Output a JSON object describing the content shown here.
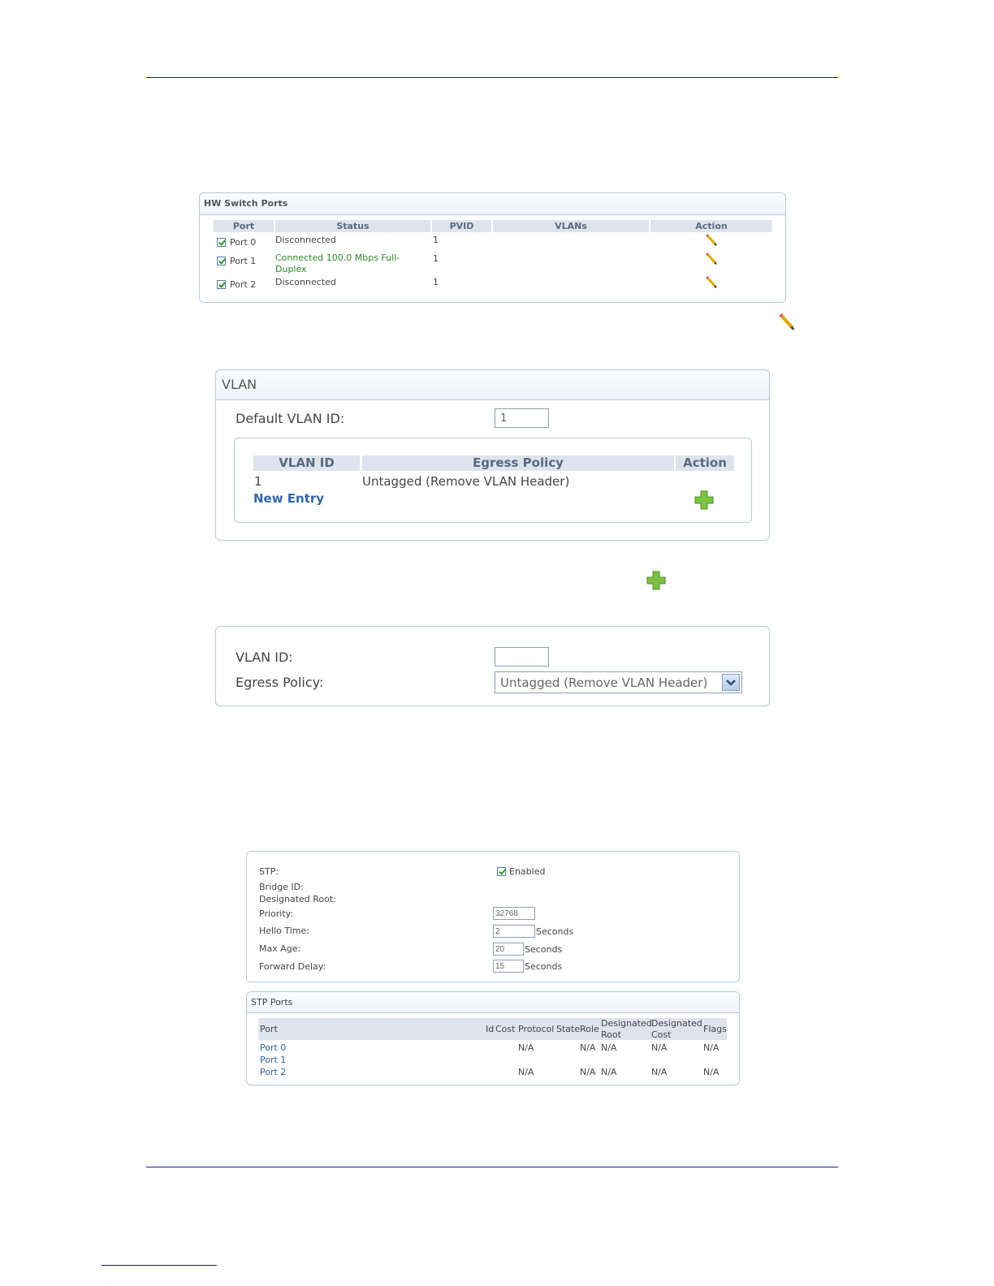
{
  "hw_switch": {
    "title": "HW Switch Ports",
    "headers": [
      "Port",
      "Status",
      "PVID",
      "VLANs",
      "Action"
    ],
    "rows": [
      {
        "port": "Port 0",
        "status_lines": [
          "Disconnected",
          ""
        ],
        "pvid": "1",
        "vlans": "",
        "connected": false
      },
      {
        "port": "Port 1",
        "status_lines": [
          "Connected 100.0 Mbps Full-",
          "Duplex"
        ],
        "pvid": "1",
        "vlans": "",
        "connected": true
      },
      {
        "port": "Port 2",
        "status_lines": [
          "Disconnected",
          ""
        ],
        "pvid": "1",
        "vlans": "",
        "connected": false
      }
    ]
  },
  "vlan": {
    "title": "VLAN",
    "default_label": "Default VLAN ID:",
    "default_value": "1",
    "headers": [
      "VLAN ID",
      "Egress Policy",
      "Action"
    ],
    "row": {
      "id": "1",
      "policy": "Untagged (Remove VLAN Header)"
    },
    "new_entry": "New Entry"
  },
  "vlan_form": {
    "id_label": "VLAN ID:",
    "id_value": "",
    "policy_label": "Egress Policy:",
    "policy_value": "Untagged (Remove VLAN Header)"
  },
  "stp": {
    "stp_label": "STP:",
    "enabled_label": "Enabled",
    "bridge_id_label": "Bridge ID:",
    "designated_root_label": "Designated Root:",
    "priority_label": "Priority:",
    "priority_value": "32768",
    "hello_label": "Hello Time:",
    "hello_value": "2",
    "max_age_label": "Max Age:",
    "max_age_value": "20",
    "fwd_label": "Forward Delay:",
    "fwd_value": "15",
    "seconds": "Seconds"
  },
  "stp_ports": {
    "title": "STP Ports",
    "headers": {
      "port": "Port",
      "id": "Id",
      "cost": "Cost",
      "protocol": "Protocol",
      "state": "State",
      "role": "Role",
      "droot_1": "Designated",
      "droot_2": "Root",
      "dcost_1": "Designated",
      "dcost_2": "Cost",
      "flags": "Flags"
    },
    "rows": [
      {
        "port": "Port 0",
        "protocol": "N/A",
        "role": "N/A",
        "droot": "N/A",
        "dcost": "N/A",
        "flags": "N/A"
      },
      {
        "port": "Port 1",
        "protocol": "",
        "role": "",
        "droot": "",
        "dcost": "",
        "flags": ""
      },
      {
        "port": "Port 2",
        "protocol": "N/A",
        "role": "N/A",
        "droot": "N/A",
        "dcost": "N/A",
        "flags": "N/A"
      }
    ]
  }
}
